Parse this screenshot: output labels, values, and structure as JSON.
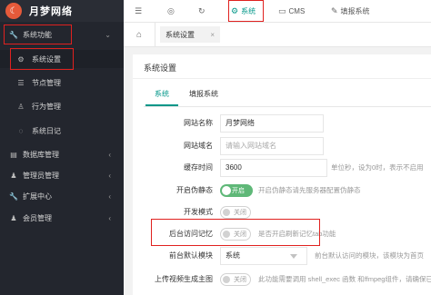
{
  "app": {
    "brand": "月梦网络"
  },
  "sidebar": {
    "items": [
      {
        "label": "系统功能",
        "icon": "wrench-icon"
      },
      {
        "label": "系统设置",
        "icon": "gear-icon"
      },
      {
        "label": "节点管理",
        "icon": "list-icon"
      },
      {
        "label": "行为管理",
        "icon": "user-icon"
      },
      {
        "label": "系统日记",
        "icon": "circle-icon"
      },
      {
        "label": "数据库管理",
        "icon": "database-icon"
      },
      {
        "label": "管理员管理",
        "icon": "person-icon"
      },
      {
        "label": "扩展中心",
        "icon": "wrench-icon"
      },
      {
        "label": "会员管理",
        "icon": "person-icon"
      }
    ]
  },
  "topbar": {
    "menu_icon": "menu-icon",
    "globe_icon": "globe-icon",
    "refresh_icon": "refresh-icon",
    "items": [
      {
        "label": "系统",
        "icon": "gear-icon"
      },
      {
        "label": "CMS",
        "icon": "cms-icon"
      },
      {
        "label": "填报系统",
        "icon": "edit-icon"
      }
    ]
  },
  "tabs": {
    "current": "系统设置",
    "close": "×"
  },
  "panel": {
    "title": "系统设置",
    "subtabs": [
      "系统",
      "填报系统"
    ],
    "fields": [
      {
        "label": "网站名称",
        "value": "月梦网络",
        "placeholder": "",
        "hint": ""
      },
      {
        "label": "网站域名",
        "value": "",
        "placeholder": "请输入网站域名",
        "hint": ""
      },
      {
        "label": "缓存时间",
        "value": "3600",
        "placeholder": "",
        "hint": "单位秒，设为0时，表示不启用"
      },
      {
        "label": "开启伪静态",
        "switch": "开启",
        "on": true,
        "hint": "开启伪静态请先服务器配置伪静态"
      },
      {
        "label": "开发模式",
        "switch": "关闭",
        "on": false,
        "hint": ""
      },
      {
        "label": "后台访问记忆",
        "switch": "关闭",
        "on": false,
        "hint": "是否开启刷新记忆tab功能"
      },
      {
        "label": "前台默认模块",
        "value": "系统",
        "hint": "前台默认访问的模块，该模块为首页"
      },
      {
        "label": "上传视频生成主图",
        "switch": "关闭",
        "on": false,
        "hint": "此功能需要调用 shell_exec 函数 和ffmpeg组件，请确保已开启"
      }
    ]
  },
  "colors": {
    "accent": "#009688",
    "switch_on": "#5fb878",
    "highlight": "#e0211f",
    "sidebar_bg": "#23262e"
  }
}
